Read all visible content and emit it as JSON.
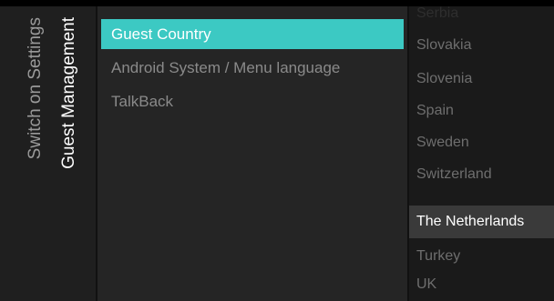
{
  "breadcrumb": {
    "level1": "Switch on Settings",
    "level2": "Guest Management"
  },
  "menu": {
    "items": [
      {
        "label": "Guest Country",
        "active": true
      },
      {
        "label": "Android System / Menu language",
        "active": false
      },
      {
        "label": "TalkBack",
        "active": false
      }
    ]
  },
  "country_list": {
    "items": [
      {
        "label": "Serbia",
        "selected": false
      },
      {
        "label": "Slovakia",
        "selected": false
      },
      {
        "label": "Slovenia",
        "selected": false
      },
      {
        "label": "Spain",
        "selected": false
      },
      {
        "label": "Sweden",
        "selected": false
      },
      {
        "label": "Switzerland",
        "selected": false
      },
      {
        "label": "The Netherlands",
        "selected": true
      },
      {
        "label": "Turkey",
        "selected": false
      },
      {
        "label": "UK",
        "selected": false
      }
    ]
  },
  "colors": {
    "accent": "#3cc9c3",
    "background": "#202020"
  }
}
